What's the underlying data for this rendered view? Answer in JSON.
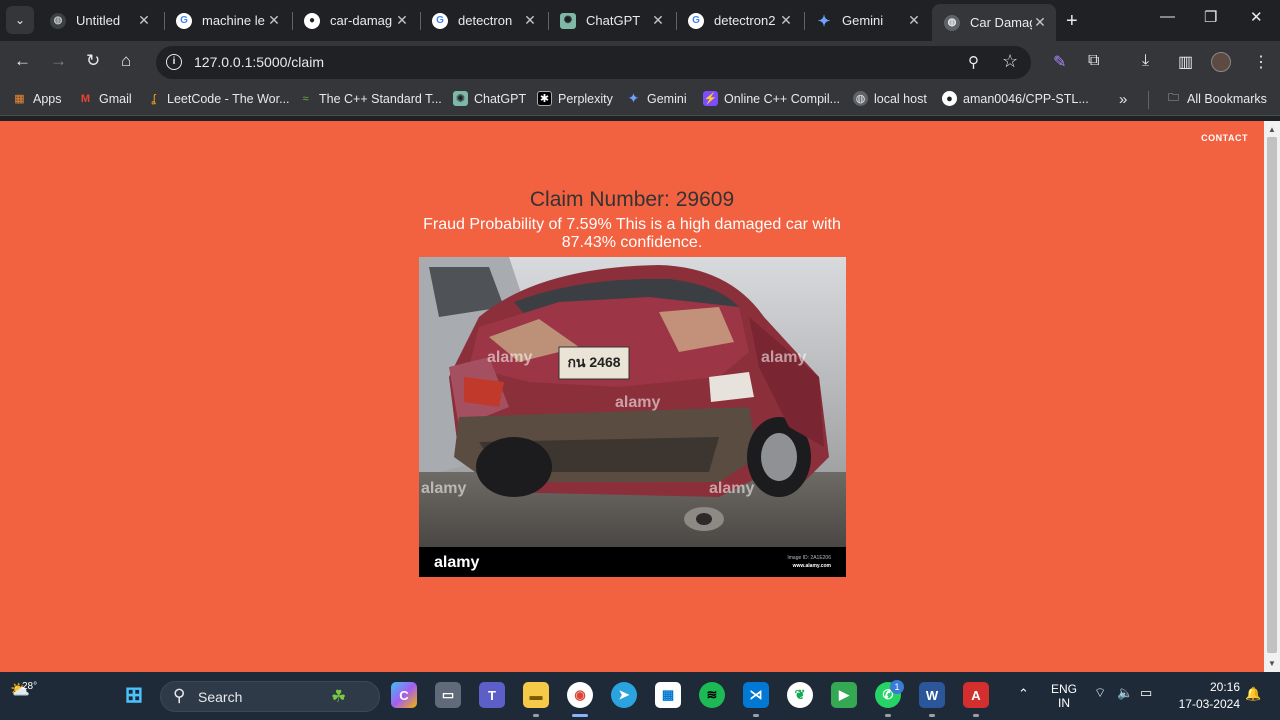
{
  "browser": {
    "tabs": [
      {
        "title": "Untitled",
        "icon": "globe-icon"
      },
      {
        "title": "machine le",
        "icon": "google-icon"
      },
      {
        "title": "car-damag",
        "icon": "github-icon"
      },
      {
        "title": "detectron",
        "icon": "google-icon"
      },
      {
        "title": "ChatGPT",
        "icon": "chatgpt-icon"
      },
      {
        "title": "detectron2",
        "icon": "google-icon"
      },
      {
        "title": "Gemini",
        "icon": "gemini-icon"
      },
      {
        "title": "Car Damag",
        "icon": "globe-icon",
        "active": true
      }
    ],
    "url": "127.0.0.1:5000/claim",
    "bookmarks": [
      {
        "label": "Apps",
        "icon": "apps-grid-icon"
      },
      {
        "label": "Gmail",
        "icon": "gmail-icon"
      },
      {
        "label": "LeetCode - The Wor...",
        "icon": "leetcode-icon"
      },
      {
        "label": "The C++ Standard T...",
        "icon": "cpp-icon"
      },
      {
        "label": "ChatGPT",
        "icon": "chatgpt-icon"
      },
      {
        "label": "Perplexity",
        "icon": "perplexity-icon"
      },
      {
        "label": "Gemini",
        "icon": "gemini-icon"
      },
      {
        "label": "Online C++ Compil...",
        "icon": "compiler-icon"
      },
      {
        "label": "local host",
        "icon": "globe-icon"
      },
      {
        "label": "aman0046/CPP-STL...",
        "icon": "github-icon"
      }
    ],
    "all_bookmarks": "All Bookmarks"
  },
  "page": {
    "contact": "CONTACT",
    "claim_title": "Claim Number: 29609",
    "fraud_text": "Fraud Probability of 7.59% This is a high damaged car with 87.43% confidence.",
    "image": {
      "watermark": "alamy",
      "footer_logo": "alamy",
      "footer_id": "Image ID: 2A1E206",
      "footer_site": "www.alamy.com",
      "plate": "กน 2468"
    }
  },
  "taskbar": {
    "weather_temp": "28°",
    "search_label": "Search",
    "lang_line1": "ENG",
    "lang_line2": "IN",
    "time": "20:16",
    "date": "17-03-2024",
    "whatsapp_badge": "1"
  },
  "colors": {
    "page_bg": "#f26140",
    "title_text": "#333333",
    "chrome_dark": "#202124",
    "chrome_toolbar": "#35363a"
  }
}
